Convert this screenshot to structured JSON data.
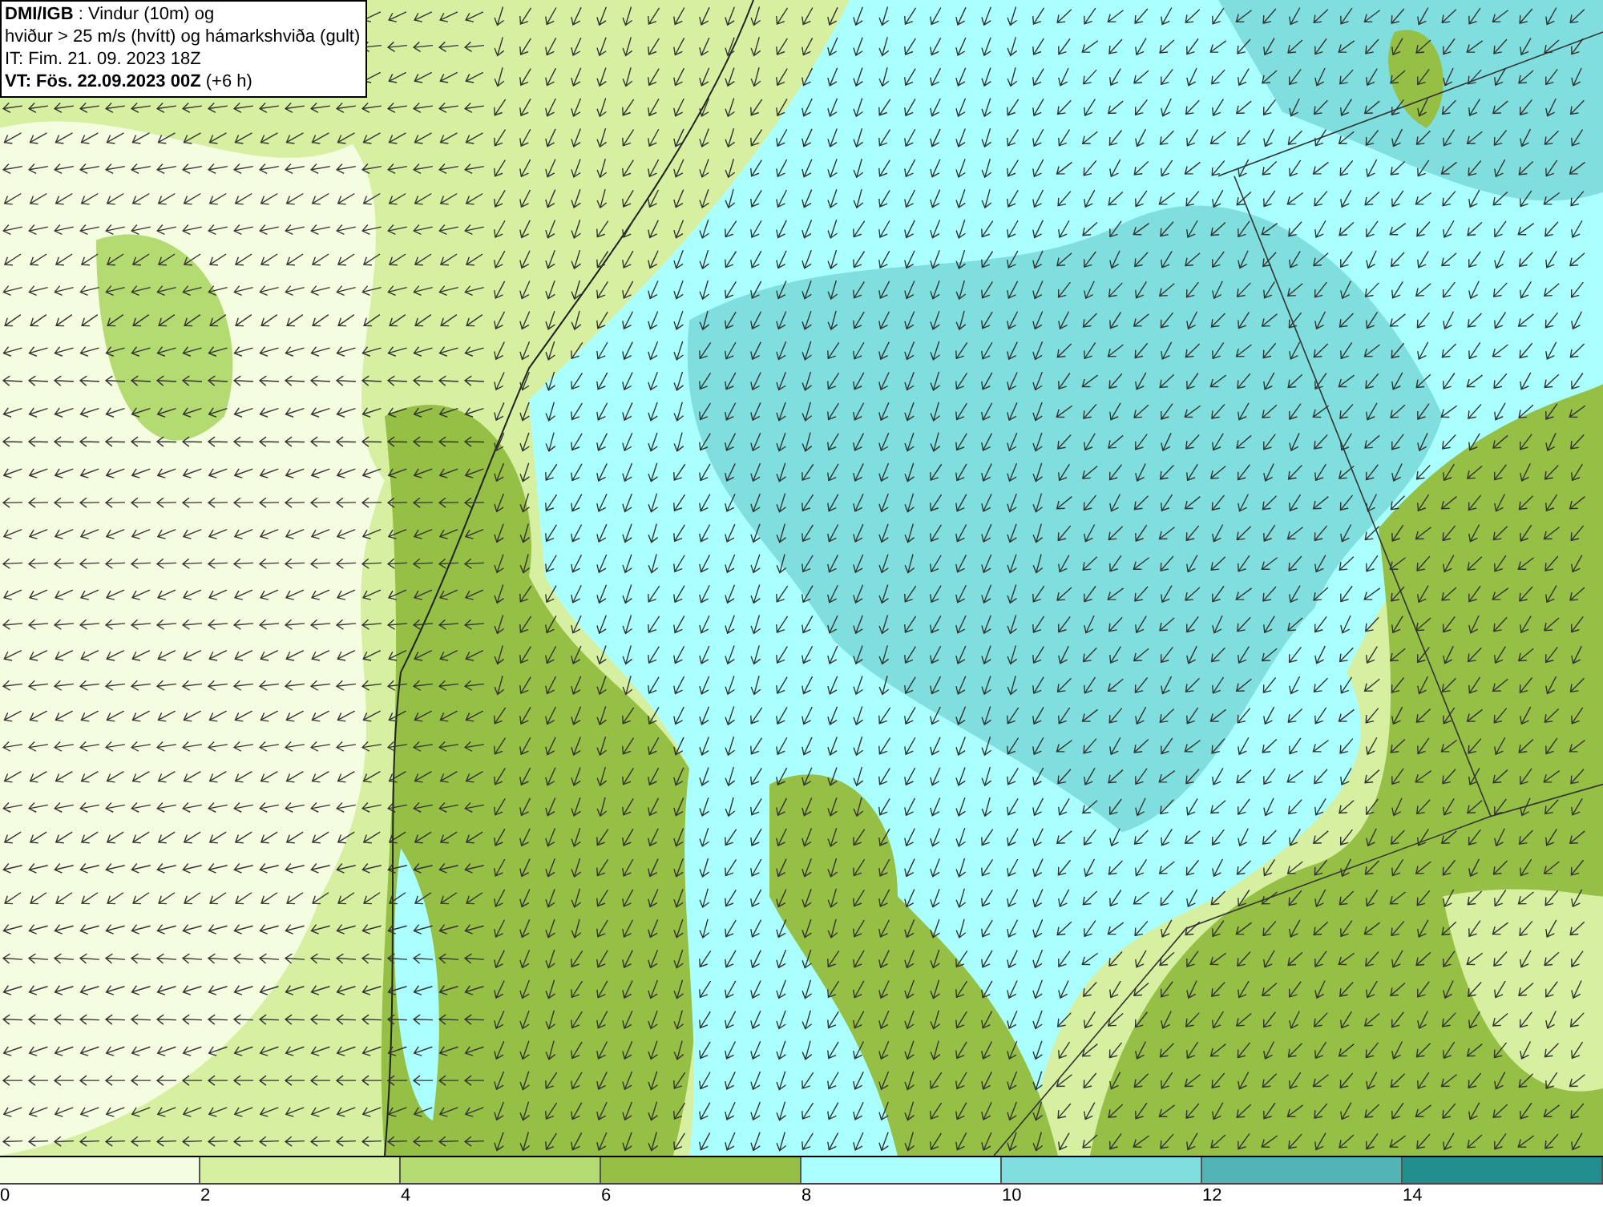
{
  "header": {
    "lines": [
      "**DMI/IGB** : Vindur (10m) og",
      "hviður > 25 m/s (hvítt) og hámarkshviða (gult)",
      "IT: Fim. 21. 09. 2023 18Z",
      "**VT: Fös. 22.09.2023 00Z** (+6 h)"
    ]
  },
  "legend": {
    "bins": [
      {
        "color": "#f5fde0"
      },
      {
        "color": "#d6efa0"
      },
      {
        "color": "#b4da72"
      },
      {
        "color": "#95bf45"
      },
      {
        "color": "#aaffff"
      },
      {
        "color": "#80dede"
      },
      {
        "color": "#52b4b4"
      },
      {
        "color": "#228e8e"
      }
    ],
    "ticks": [
      "0",
      "2",
      "4",
      "6",
      "8",
      "10",
      "12",
      "14"
    ]
  }
}
